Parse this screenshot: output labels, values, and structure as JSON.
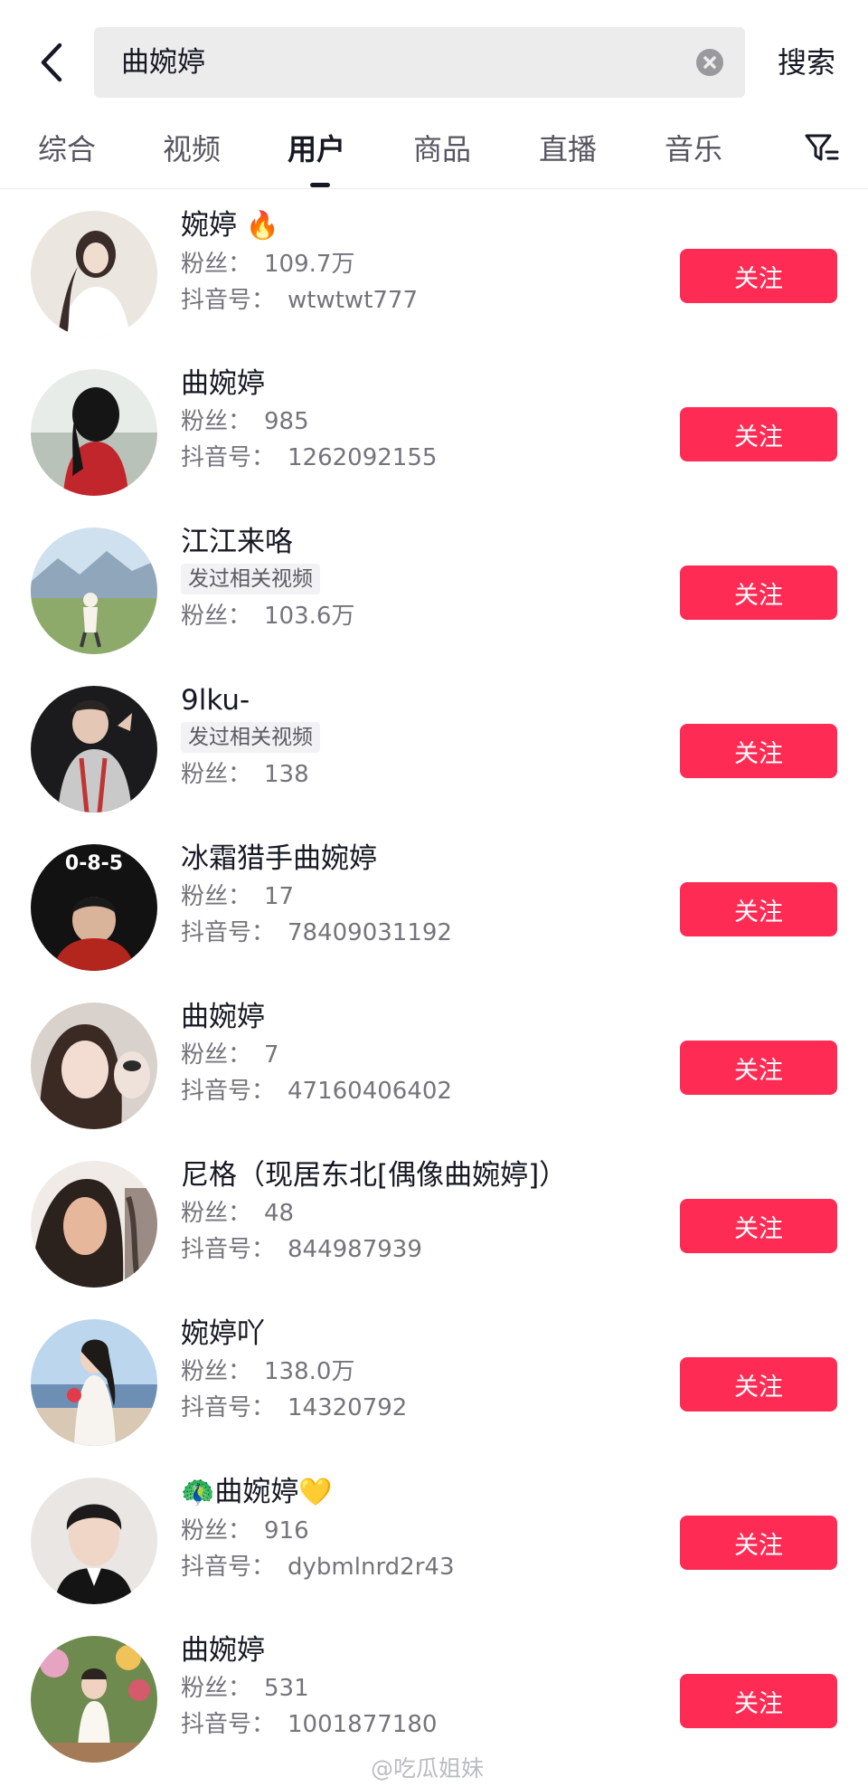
{
  "search": {
    "query": "曲婉婷",
    "submit_label": "搜索"
  },
  "tabs": [
    {
      "label": "综合"
    },
    {
      "label": "视频"
    },
    {
      "label": "用户",
      "active": true
    },
    {
      "label": "商品"
    },
    {
      "label": "直播"
    },
    {
      "label": "音乐"
    }
  ],
  "icons": {
    "back": "chevron-left-icon",
    "clear": "clear-circle-icon",
    "filter": "filter-icon",
    "fire": "fire-emoji",
    "peacock": "peacock-emoji",
    "heart": "yellow-heart-emoji"
  },
  "colors": {
    "accent": "#fe2c55",
    "search_bg": "#ececec",
    "text_primary": "#161823",
    "text_secondary": "#74757c"
  },
  "follow_label": "关注",
  "fans_label": "粉丝：",
  "id_label": "抖音号：",
  "users": [
    {
      "name": "婉婷",
      "suffix": "🔥",
      "fans": "109.7万",
      "douyin_id": "wtwtwt777"
    },
    {
      "name": "曲婉婷",
      "fans": "985",
      "douyin_id": "1262092155"
    },
    {
      "name": "江江来咯",
      "tag": "发过相关视频",
      "fans": "103.6万"
    },
    {
      "name": "9lku-",
      "tag": "发过相关视频",
      "fans": "138"
    },
    {
      "name": "冰霜猎手曲婉婷",
      "fans": "17",
      "douyin_id": "78409031192",
      "avatar_text": "0-8-5"
    },
    {
      "name": "曲婉婷",
      "fans": "7",
      "douyin_id": "47160406402"
    },
    {
      "name": "尼格（现居东北[偶像曲婉婷]）",
      "fans": "48",
      "douyin_id": "844987939"
    },
    {
      "name": "婉婷吖",
      "fans": "138.0万",
      "douyin_id": "14320792"
    },
    {
      "prefix": "🦚",
      "name": "曲婉婷",
      "suffix": "💛",
      "fans": "916",
      "douyin_id": "dybmlnrd2r43"
    },
    {
      "name": "曲婉婷",
      "fans": "531",
      "douyin_id": "1001877180"
    }
  ],
  "watermark": "@吃瓜姐妹"
}
